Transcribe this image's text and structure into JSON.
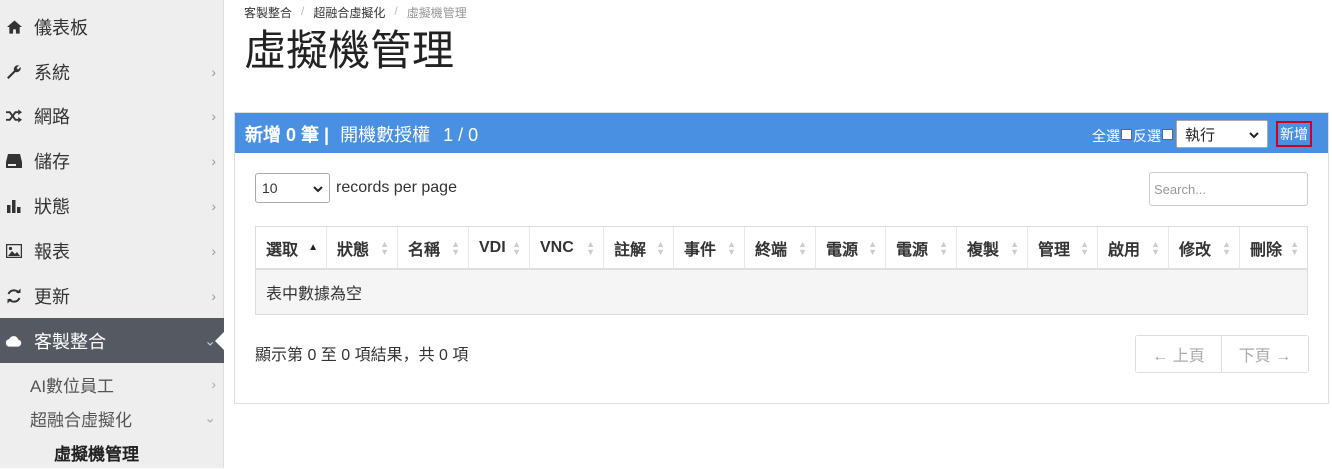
{
  "sidebar": {
    "items": [
      {
        "label": "儀表板",
        "icon": "home-icon"
      },
      {
        "label": "系統",
        "icon": "wrench-icon"
      },
      {
        "label": "網路",
        "icon": "shuffle-icon"
      },
      {
        "label": "儲存",
        "icon": "hdd-icon"
      },
      {
        "label": "狀態",
        "icon": "bar-chart-icon"
      },
      {
        "label": "報表",
        "icon": "image-icon"
      },
      {
        "label": "更新",
        "icon": "refresh-icon"
      },
      {
        "label": "客製整合",
        "icon": "cloud-icon"
      }
    ],
    "subitems": [
      {
        "label": "AI數位員工"
      },
      {
        "label": "超融合虛擬化"
      },
      {
        "label": "虛擬機管理"
      }
    ]
  },
  "breadcrumb": [
    "客製整合",
    "超融合虛擬化",
    "虛擬機管理"
  ],
  "page_title": "虛擬機管理",
  "panel": {
    "title_add": "新增 0 筆 |",
    "title_license": "開機數授權",
    "title_count": "1 / 0",
    "select_all": "全選",
    "invert": "反選",
    "action_value": "執行",
    "add_button": "新增"
  },
  "table": {
    "length_value": "10",
    "length_label": "records per page",
    "search_placeholder": "Search...",
    "columns": [
      "選取",
      "狀態",
      "名稱",
      "VDI",
      "VNC",
      "註解",
      "事件",
      "終端",
      "電源",
      "電源",
      "複製",
      "管理",
      "啟用",
      "修改",
      "刪除"
    ],
    "empty_text": "表中數據為空",
    "info": "顯示第 0 至 0 項結果，共 0 項",
    "prev": "← 上頁",
    "next": "下頁 →"
  }
}
